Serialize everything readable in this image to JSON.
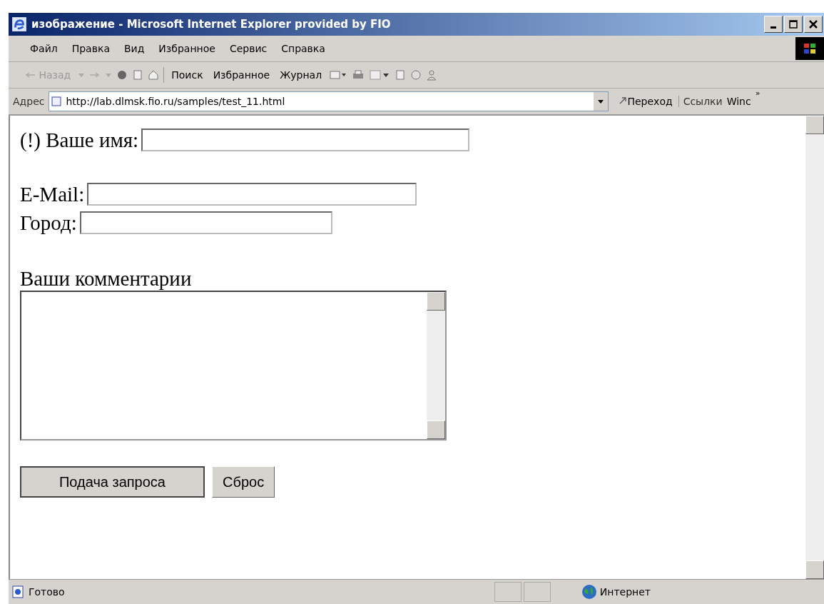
{
  "window": {
    "title": "изображение - Microsoft Internet Explorer provided by FIO"
  },
  "menu": [
    "Файл",
    "Правка",
    "Вид",
    "Избранное",
    "Сервис",
    "Справка"
  ],
  "toolbar": {
    "back": {
      "label": "Назад",
      "disabled": true
    },
    "buttons": [
      "Поиск",
      "Избранное",
      "Журнал"
    ]
  },
  "address": {
    "label": "Адрес",
    "value": "http://lab.dlmsk.fio.ru/samples/test_11.html",
    "go": "Переход",
    "links": "Ссылки",
    "link_item": "Winc",
    "more": "»"
  },
  "form": {
    "fields": [
      {
        "label": "(!) Ваше имя:"
      },
      {
        "label": "E-Mail:"
      },
      {
        "label": "Город:"
      }
    ],
    "comments_label": "Ваши комментарии",
    "buttons": [
      "Подача запроса",
      "Сброс"
    ]
  },
  "status_bar": {
    "text": "Готово",
    "zone": "Интернет"
  }
}
